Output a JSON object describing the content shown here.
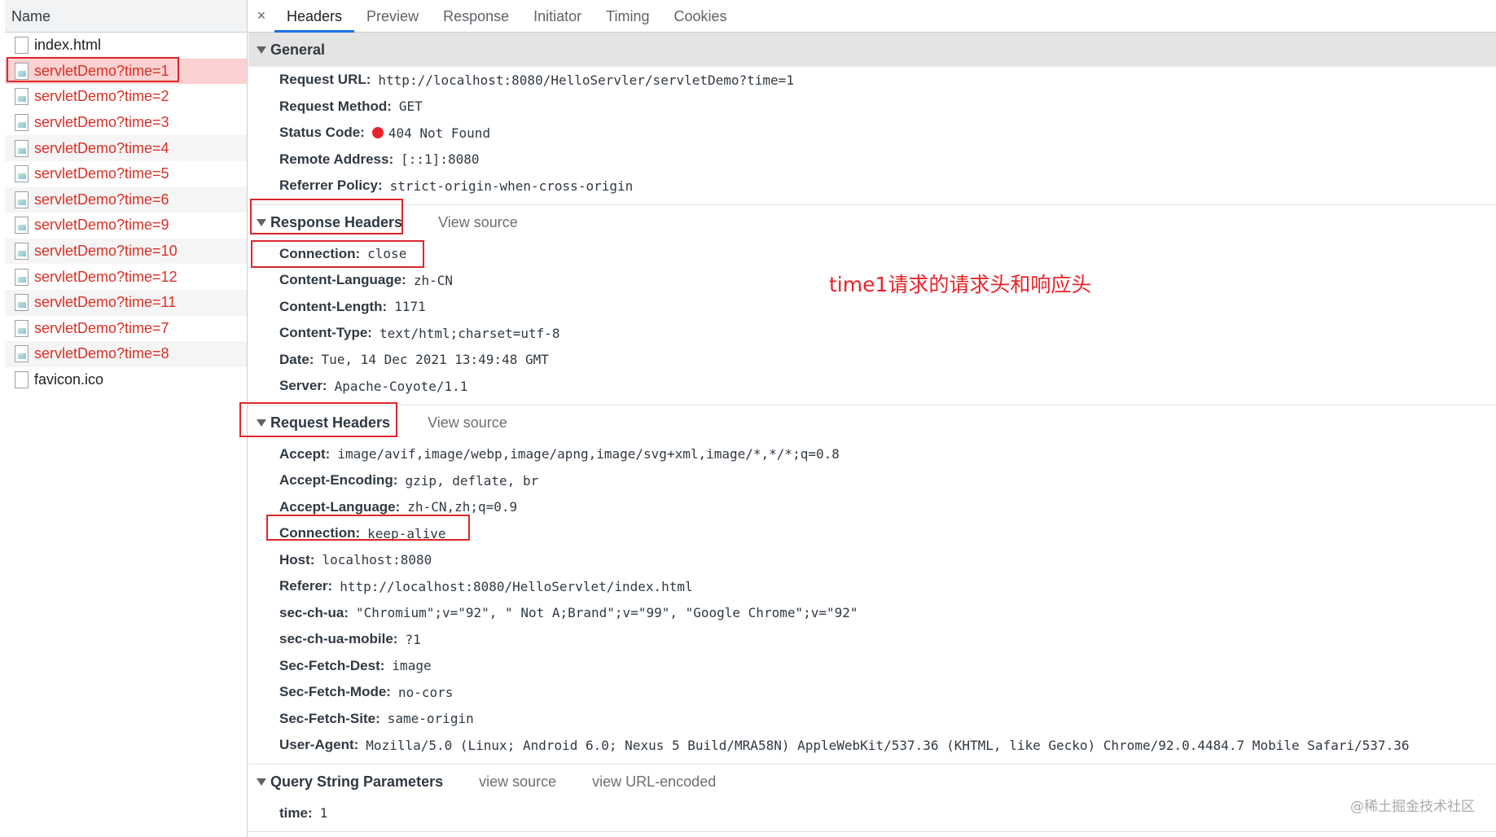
{
  "left_panel": {
    "header": "Name",
    "requests": [
      {
        "label": "index.html",
        "error": false
      },
      {
        "label": "servletDemo?time=1",
        "error": true
      },
      {
        "label": "servletDemo?time=2",
        "error": true
      },
      {
        "label": "servletDemo?time=3",
        "error": true
      },
      {
        "label": "servletDemo?time=4",
        "error": true
      },
      {
        "label": "servletDemo?time=5",
        "error": true
      },
      {
        "label": "servletDemo?time=6",
        "error": true
      },
      {
        "label": "servletDemo?time=9",
        "error": true
      },
      {
        "label": "servletDemo?time=10",
        "error": true
      },
      {
        "label": "servletDemo?time=12",
        "error": true
      },
      {
        "label": "servletDemo?time=11",
        "error": true
      },
      {
        "label": "servletDemo?time=7",
        "error": true
      },
      {
        "label": "servletDemo?time=8",
        "error": true
      },
      {
        "label": "favicon.ico",
        "error": false
      }
    ]
  },
  "tabs": {
    "close": "×",
    "items": [
      "Headers",
      "Preview",
      "Response",
      "Initiator",
      "Timing",
      "Cookies"
    ],
    "active": "Headers"
  },
  "general": {
    "title": "General",
    "rows": [
      {
        "name": "Request URL:",
        "value": "http://localhost:8080/HelloServler/servletDemo?time=1"
      },
      {
        "name": "Request Method:",
        "value": "GET"
      },
      {
        "name": "Status Code:",
        "value": "404 Not Found"
      },
      {
        "name": "Remote Address:",
        "value": "[::1]:8080"
      },
      {
        "name": "Referrer Policy:",
        "value": "strict-origin-when-cross-origin"
      }
    ]
  },
  "response_headers": {
    "title": "Response Headers",
    "view_source": "View source",
    "rows": [
      {
        "name": "Connection:",
        "value": "close"
      },
      {
        "name": "Content-Language:",
        "value": "zh-CN"
      },
      {
        "name": "Content-Length:",
        "value": "1171"
      },
      {
        "name": "Content-Type:",
        "value": "text/html;charset=utf-8"
      },
      {
        "name": "Date:",
        "value": "Tue, 14 Dec 2021 13:49:48 GMT"
      },
      {
        "name": "Server:",
        "value": "Apache-Coyote/1.1"
      }
    ]
  },
  "request_headers": {
    "title": "Request Headers",
    "view_source": "View source",
    "rows": [
      {
        "name": "Accept:",
        "value": "image/avif,image/webp,image/apng,image/svg+xml,image/*,*/*;q=0.8"
      },
      {
        "name": "Accept-Encoding:",
        "value": "gzip, deflate, br"
      },
      {
        "name": "Accept-Language:",
        "value": "zh-CN,zh;q=0.9"
      },
      {
        "name": "Connection:",
        "value": "keep-alive"
      },
      {
        "name": "Host:",
        "value": "localhost:8080"
      },
      {
        "name": "Referer:",
        "value": "http://localhost:8080/HelloServlet/index.html"
      },
      {
        "name": "sec-ch-ua:",
        "value": "\"Chromium\";v=\"92\", \" Not A;Brand\";v=\"99\", \"Google Chrome\";v=\"92\""
      },
      {
        "name": "sec-ch-ua-mobile:",
        "value": "?1"
      },
      {
        "name": "Sec-Fetch-Dest:",
        "value": "image"
      },
      {
        "name": "Sec-Fetch-Mode:",
        "value": "no-cors"
      },
      {
        "name": "Sec-Fetch-Site:",
        "value": "same-origin"
      },
      {
        "name": "User-Agent:",
        "value": "Mozilla/5.0 (Linux; Android 6.0; Nexus 5 Build/MRA58N) AppleWebKit/537.36 (KHTML, like Gecko) Chrome/92.0.4484.7 Mobile Safari/537.36"
      }
    ]
  },
  "query_params": {
    "title": "Query String Parameters",
    "view_source": "view source",
    "view_url_encoded": "view URL-encoded",
    "rows": [
      {
        "name": "time:",
        "value": "1"
      }
    ]
  },
  "annotation": "time1请求的请求头和响应头",
  "watermark": "@稀土掘金技术社区",
  "colors": {
    "annotation_red": "#e8242a",
    "box_red": "#e0262b",
    "status_dot": "#e8242a",
    "tab_active": "#1a73e8"
  }
}
